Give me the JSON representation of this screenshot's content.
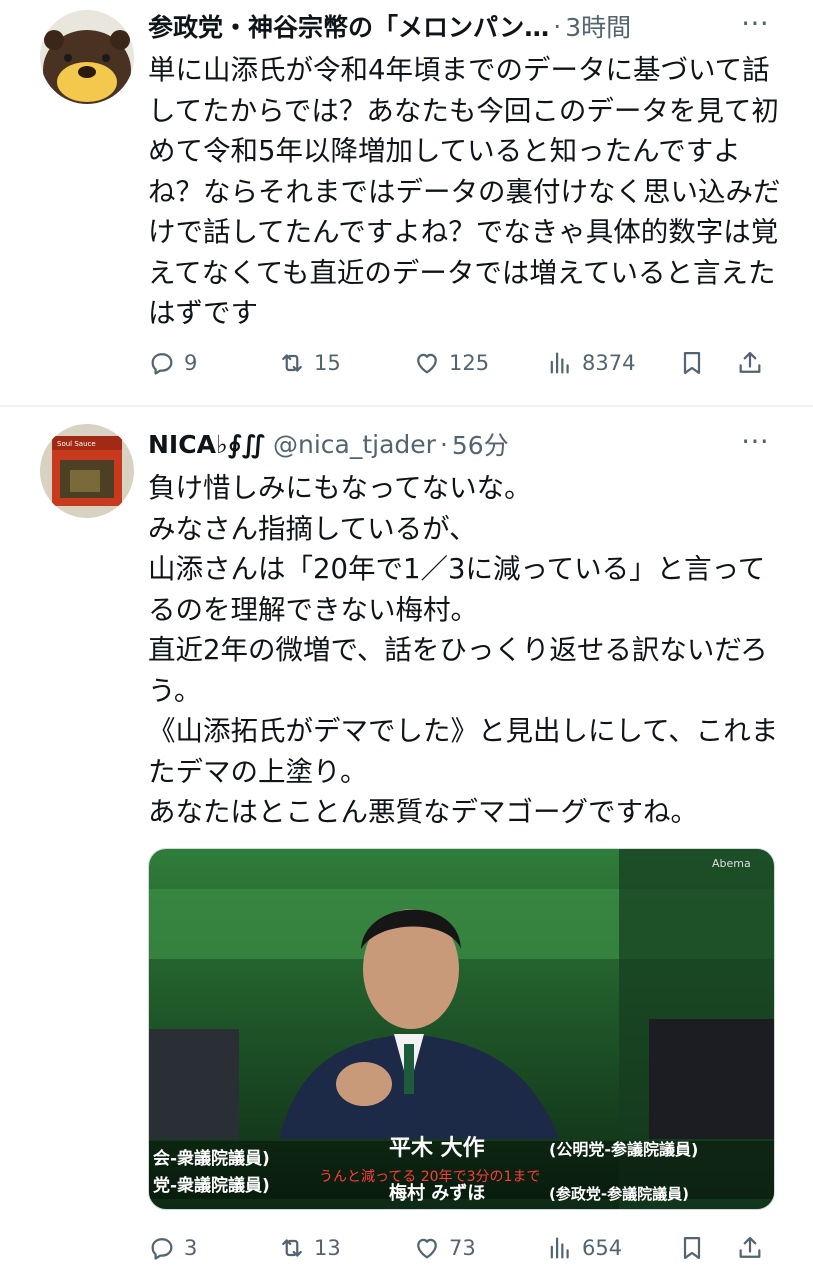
{
  "tweets": [
    {
      "display_name": "参政党・神谷宗幣の「メロンパン…",
      "handle": "",
      "timestamp": "3時間",
      "text": "単に山添氏が令和4年頃までのデータに基づいて話してたからでは？あなたも今回このデータを見て初めて令和5年以降増加していると知ったんですよね？ならそれまではデータの裏付けなく思い込みだけで話してたんですよね？でなきゃ具体的数字は覚えてなくても直近のデータでは増えていると言えたはずです",
      "replies": "9",
      "retweets": "15",
      "likes": "125",
      "views": "8374",
      "avatar_icon": "bear-mascot-avatar"
    },
    {
      "display_name": "NICA♭∮∬",
      "handle": "@nica_tjader",
      "timestamp": "56分",
      "text": "負け惜しみにもなってないな。\nみなさん指摘しているが、\n山添さんは「20年で1／3に減っている」と言ってるのを理解できない梅村。\n直近2年の微増で、話をひっくり返せる訳ないだろう。\n《山添拓氏がデマでした》と見出しにして、これまたデマの上塗り。\nあなたはとことん悪質なデマゴーグですね。",
      "replies": "3",
      "retweets": "13",
      "likes": "73",
      "views": "654",
      "avatar_icon": "album-cover-avatar",
      "media": {
        "watermark": "Abema",
        "caption_name": "平木 大作",
        "caption_party": "(公明党-参議院議員)",
        "caption_left_top": "会-衆議院議員)",
        "caption_left_bottom": "党-衆議院議員)",
        "subtitle": "うんと減ってる 20年で3分の1まで",
        "caption_name2": "梅村 みずほ",
        "caption_party2": "(参政党-参議院議員)"
      }
    }
  ],
  "colors": {
    "text": "#0f1419",
    "muted": "#536471",
    "divider": "#eff3f4"
  },
  "icons": [
    "reply-icon",
    "retweet-icon",
    "like-icon",
    "views-icon",
    "bookmark-icon",
    "share-icon",
    "more-icon"
  ]
}
